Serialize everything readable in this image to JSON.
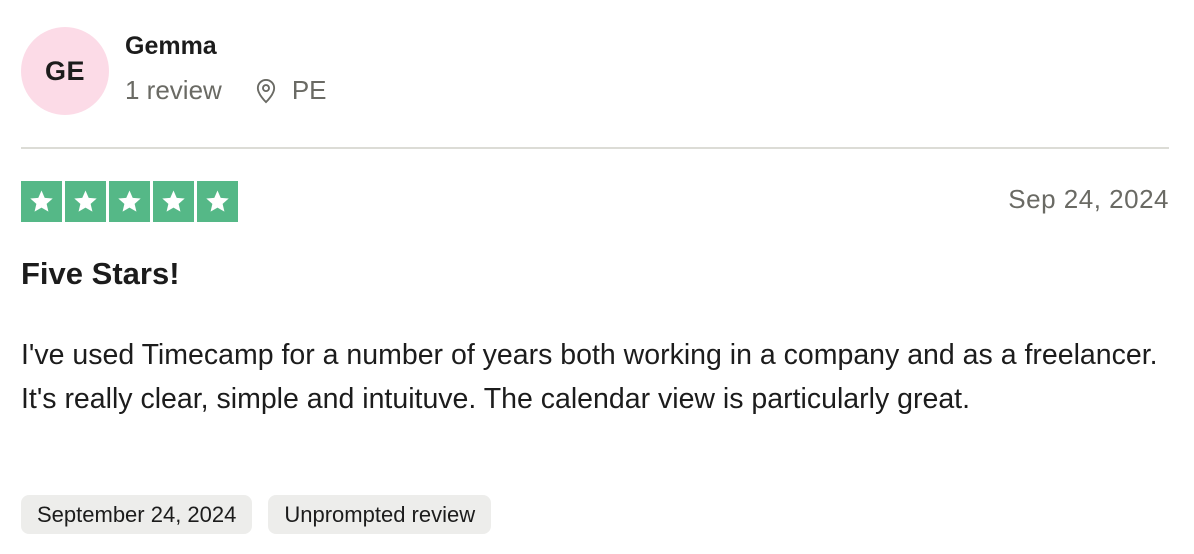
{
  "reviewer": {
    "initials": "GE",
    "avatar_color": "#fcdbe7",
    "name": "Gemma",
    "review_count": "1 review",
    "location_icon": "location-pin-icon",
    "location": "PE"
  },
  "review": {
    "rating": 5,
    "rating_max": 5,
    "star_color": "#55b887",
    "date": "Sep 24, 2024",
    "title": "Five Stars!",
    "body": "I've used Timecamp for a number of years both working in a company and as a freelancer. It's really clear, simple and intuituve. The calendar view is particularly great."
  },
  "tags": [
    {
      "label": "September 24, 2024"
    },
    {
      "label": "Unprompted review"
    }
  ]
}
